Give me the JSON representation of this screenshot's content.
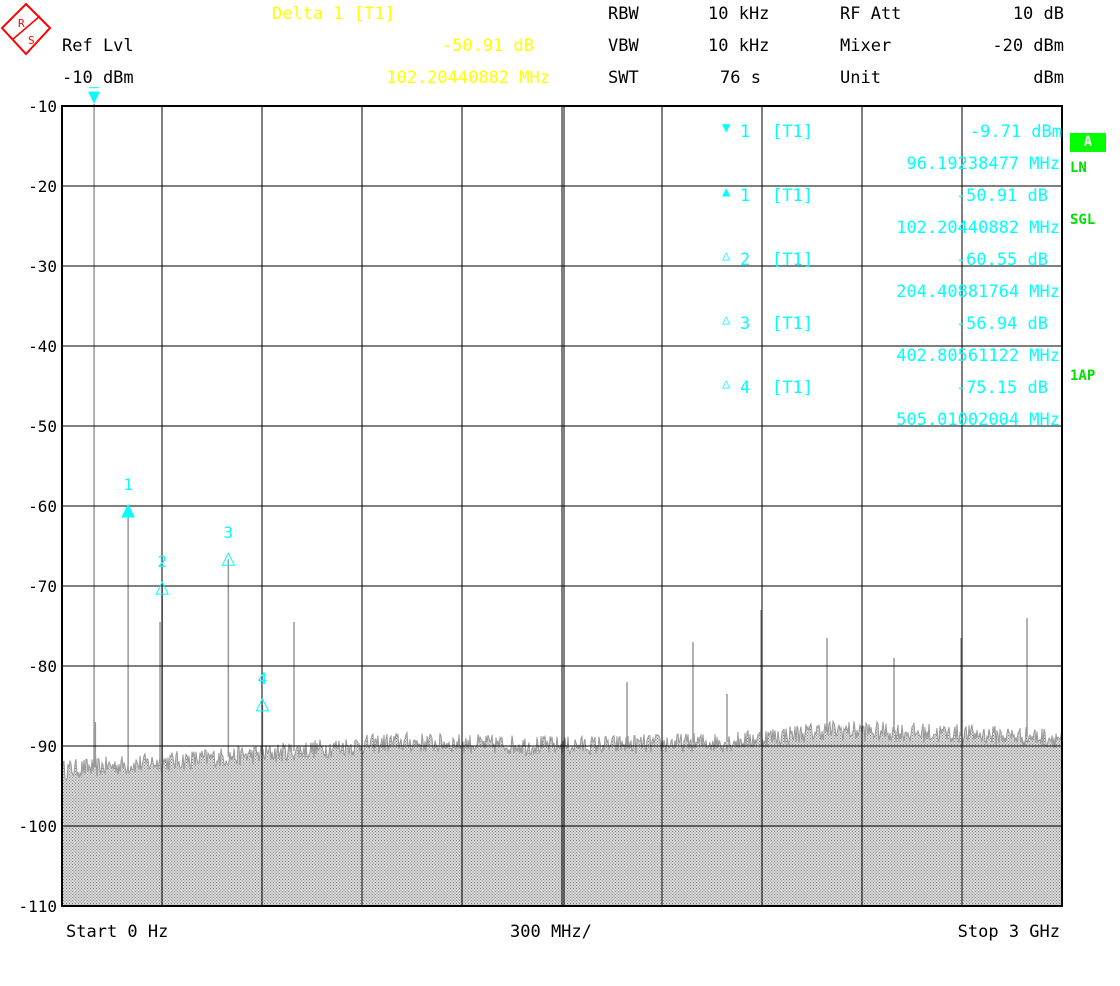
{
  "header": {
    "marker_mode": "Delta 1 [T1]",
    "ref_lvl_label": "Ref Lvl",
    "ref_lvl_value": "-10 dBm",
    "marker_level": "-50.91 dB",
    "marker_freq": "102.20440882 MHz",
    "rbw_label": "RBW",
    "rbw_value": "10 kHz",
    "vbw_label": "VBW",
    "vbw_value": "10 kHz",
    "swt_label": "SWT",
    "swt_value": "76 s",
    "rfatt_label": "RF Att",
    "rfatt_value": "10 dB",
    "mixer_label": "Mixer",
    "mixer_value": "-20 dBm",
    "unit_label": "Unit",
    "unit_value": "dBm"
  },
  "side": {
    "trace": "A",
    "detector": "LN",
    "sweep": "SGL",
    "trace_mode": "1AP"
  },
  "marker_table": [
    {
      "id": "1",
      "trace": "[T1]",
      "value": "-9.71 dBm",
      "freq": "96.19238477 MHz",
      "type": "reference"
    },
    {
      "id": "1",
      "trace": "[T1]",
      "value": "-50.91 dB",
      "freq": "102.20440882 MHz",
      "type": "delta-active"
    },
    {
      "id": "2",
      "trace": "[T1]",
      "value": "-60.55 dB",
      "freq": "204.40881764 MHz",
      "type": "delta"
    },
    {
      "id": "3",
      "trace": "[T1]",
      "value": "-56.94 dB",
      "freq": "402.80561122 MHz",
      "type": "delta"
    },
    {
      "id": "4",
      "trace": "[T1]",
      "value": "-75.15 dB",
      "freq": "505.01002004 MHz",
      "type": "delta"
    }
  ],
  "footer": {
    "start": "Start 0 Hz",
    "span": "300 MHz/",
    "stop": "Stop 3 GHz"
  },
  "colors": {
    "marker": "#00ffff",
    "header_marker": "#ffff00",
    "status": "#00ff00",
    "trace": "#999999",
    "logo": "#ff0000"
  },
  "chart_data": {
    "type": "line",
    "xlabel": "",
    "ylabel": "",
    "xlim": [
      0,
      3000
    ],
    "x_unit": "MHz",
    "ylim": [
      -110,
      -10
    ],
    "y_unit": "dBm",
    "grid": true,
    "yticks": [
      "-10",
      "-20",
      "-30",
      "-40",
      "-50",
      "-60",
      "-70",
      "-80",
      "-90",
      "-100",
      "-110"
    ],
    "noise_floor": [
      [
        0,
        -93
      ],
      [
        300,
        -92
      ],
      [
        600,
        -91
      ],
      [
        1000,
        -89.5
      ],
      [
        1500,
        -90
      ],
      [
        2000,
        -89.5
      ],
      [
        2300,
        -88
      ],
      [
        2700,
        -88.5
      ],
      [
        3000,
        -89
      ]
    ],
    "peaks": [
      [
        96.2,
        -9.71
      ],
      [
        100,
        -87
      ],
      [
        198.4,
        -60.62
      ],
      [
        294,
        -74.5
      ],
      [
        300.6,
        -70.26
      ],
      [
        499,
        -66.65
      ],
      [
        601.2,
        -84.86
      ],
      [
        696,
        -74.5
      ],
      [
        1695,
        -82
      ],
      [
        1893,
        -77
      ],
      [
        1995,
        -83.5
      ],
      [
        2097,
        -73
      ],
      [
        2295,
        -76.5
      ],
      [
        2496,
        -79
      ],
      [
        2697,
        -76.5
      ],
      [
        2895,
        -74
      ]
    ],
    "markers": [
      {
        "label": "1",
        "freq": 96.19,
        "level": -9.71,
        "type": "reference"
      },
      {
        "label": "1",
        "freq": 198.4,
        "level": -60.62,
        "type": "delta-active"
      },
      {
        "label": "2",
        "freq": 300.6,
        "level": -70.26,
        "type": "delta"
      },
      {
        "label": "3",
        "freq": 499.0,
        "level": -66.65,
        "type": "delta"
      },
      {
        "label": "4",
        "freq": 601.2,
        "level": -84.86,
        "type": "delta"
      }
    ]
  }
}
